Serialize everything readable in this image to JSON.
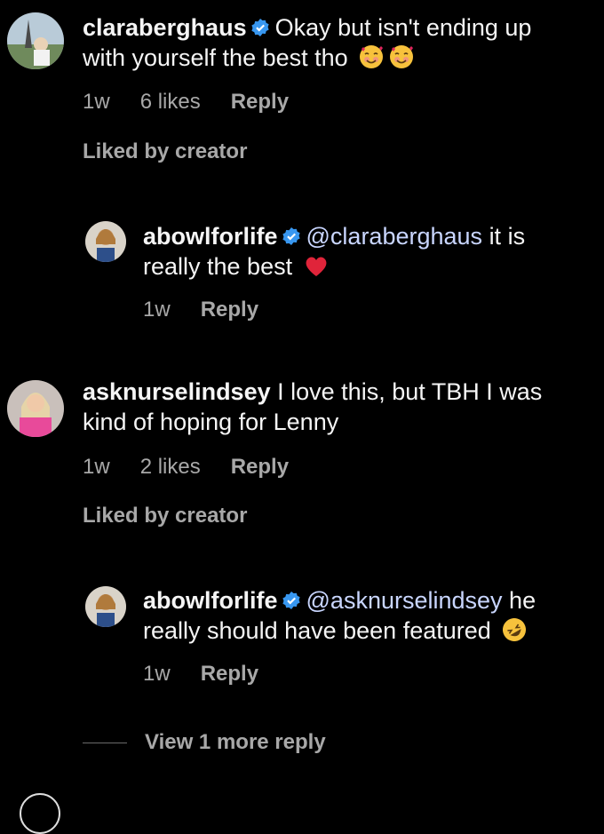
{
  "comments": [
    {
      "username": "claraberghaus",
      "verified": true,
      "mention": "",
      "text": "Okay but isn't ending up with yourself the best tho",
      "emoji": [
        "smiling-face-with-hearts-icon",
        "smiling-face-with-hearts-icon"
      ],
      "time": "1w",
      "likes": "6 likes",
      "reply_label": "Reply",
      "liked_by": "Liked by creator"
    },
    {
      "username": "abowlforlife",
      "verified": true,
      "mention": "@claraberghaus",
      "text": "it is really the best",
      "emoji": [
        "red-heart-icon"
      ],
      "time": "1w",
      "reply_label": "Reply"
    },
    {
      "username": "asknurselindsey",
      "verified": false,
      "mention": "",
      "text": "I love this, but TBH I was kind of hoping for Lenny",
      "time": "1w",
      "likes": "2 likes",
      "reply_label": "Reply",
      "liked_by": "Liked by creator"
    },
    {
      "username": "abowlforlife",
      "verified": true,
      "mention": "@asknurselindsey",
      "text": "he really should have been featured",
      "emoji": [
        "rolling-on-floor-laughing-icon"
      ],
      "time": "1w",
      "reply_label": "Reply"
    }
  ],
  "view_more_replies": "View 1 more reply",
  "colors": {
    "background": "#000000",
    "text": "#f5f5f5",
    "secondary": "#a8a8a8",
    "mention": "#c9d6ff",
    "verified": "#3897f0"
  }
}
